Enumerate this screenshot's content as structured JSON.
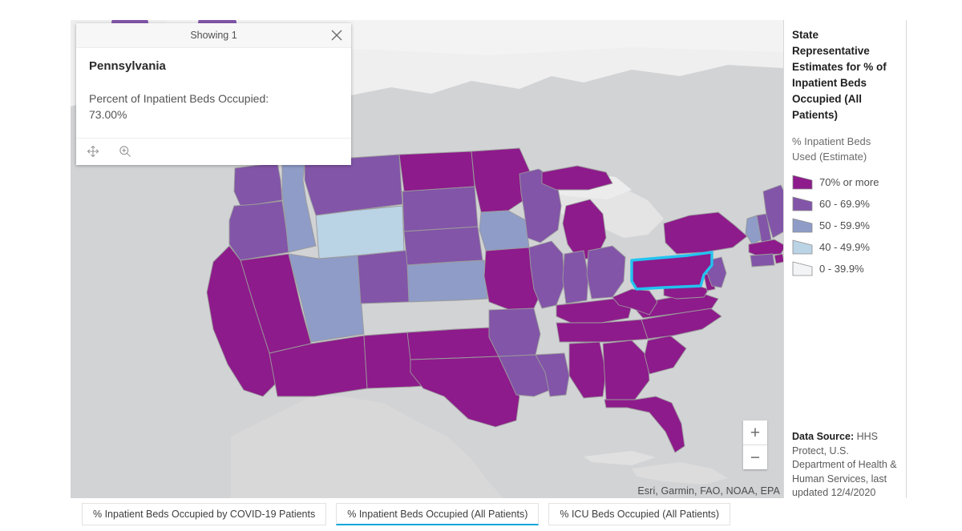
{
  "popup": {
    "header_title": "Showing 1",
    "close_icon": "close-icon",
    "feature_name": "Pennsylvania",
    "field_label": "Percent of Inpatient Beds Occupied:",
    "field_value": "73.00%",
    "actions": [
      {
        "icon": "pan-icon",
        "name": "pan-to-feature"
      },
      {
        "icon": "zoom-in-icon",
        "name": "zoom-to-feature"
      }
    ]
  },
  "legend": {
    "title": "State Representative Estimates for % of Inpatient Beds Occupied (All Patients)",
    "subtitle": "% Inpatient Beds Used (Estimate)",
    "items": [
      {
        "label": "70% or more",
        "color": "#8d1b8b"
      },
      {
        "label": "60 - 69.9%",
        "color": "#8255a8"
      },
      {
        "label": "50 - 59.9%",
        "color": "#8e9cc7"
      },
      {
        "label": "40 - 49.9%",
        "color": "#bad3e5"
      },
      {
        "label": "0 - 39.9%",
        "color": "#f2f4f6"
      }
    ],
    "source_label": "Data Source:",
    "source_text": " HHS Protect, U.S. Department of Health & Human Services, last updated 12/4/2020"
  },
  "map": {
    "attribution": "Esri, Garmin, FAO, NOAA, EPA",
    "zoom_in_label": "+",
    "zoom_out_label": "−",
    "selected_state": "Pennsylvania",
    "selection_outline_color": "#22c3f0",
    "background_color": "#d2d3d5",
    "land_color": "#e8e8e8",
    "water_color": "#f3f3f3",
    "state_values": [
      {
        "state": "WA",
        "bucket": "60 - 69.9%"
      },
      {
        "state": "OR",
        "bucket": "60 - 69.9%"
      },
      {
        "state": "CA",
        "bucket": "70% or more"
      },
      {
        "state": "NV",
        "bucket": "70% or more"
      },
      {
        "state": "ID",
        "bucket": "50 - 59.9%"
      },
      {
        "state": "MT",
        "bucket": "60 - 69.9%"
      },
      {
        "state": "WY",
        "bucket": "40 - 49.9%"
      },
      {
        "state": "UT",
        "bucket": "50 - 59.9%"
      },
      {
        "state": "AZ",
        "bucket": "70% or more"
      },
      {
        "state": "CO",
        "bucket": "60 - 69.9%"
      },
      {
        "state": "NM",
        "bucket": "70% or more"
      },
      {
        "state": "ND",
        "bucket": "70% or more"
      },
      {
        "state": "SD",
        "bucket": "60 - 69.9%"
      },
      {
        "state": "NE",
        "bucket": "60 - 69.9%"
      },
      {
        "state": "KS",
        "bucket": "50 - 59.9%"
      },
      {
        "state": "OK",
        "bucket": "70% or more"
      },
      {
        "state": "TX",
        "bucket": "70% or more"
      },
      {
        "state": "MN",
        "bucket": "70% or more"
      },
      {
        "state": "IA",
        "bucket": "50 - 59.9%"
      },
      {
        "state": "MO",
        "bucket": "70% or more"
      },
      {
        "state": "AR",
        "bucket": "60 - 69.9%"
      },
      {
        "state": "LA",
        "bucket": "60 - 69.9%"
      },
      {
        "state": "WI",
        "bucket": "60 - 69.9%"
      },
      {
        "state": "IL",
        "bucket": "60 - 69.9%"
      },
      {
        "state": "MS",
        "bucket": "60 - 69.9%"
      },
      {
        "state": "MI",
        "bucket": "70% or more"
      },
      {
        "state": "IN",
        "bucket": "60 - 69.9%"
      },
      {
        "state": "OH",
        "bucket": "60 - 69.9%"
      },
      {
        "state": "KY",
        "bucket": "70% or more"
      },
      {
        "state": "TN",
        "bucket": "70% or more"
      },
      {
        "state": "AL",
        "bucket": "70% or more"
      },
      {
        "state": "GA",
        "bucket": "70% or more"
      },
      {
        "state": "FL",
        "bucket": "70% or more"
      },
      {
        "state": "SC",
        "bucket": "70% or more"
      },
      {
        "state": "NC",
        "bucket": "70% or more"
      },
      {
        "state": "VA",
        "bucket": "70% or more"
      },
      {
        "state": "WV",
        "bucket": "70% or more"
      },
      {
        "state": "PA",
        "bucket": "70% or more"
      },
      {
        "state": "NY",
        "bucket": "70% or more"
      },
      {
        "state": "VT",
        "bucket": "50 - 59.9%"
      },
      {
        "state": "NH",
        "bucket": "60 - 69.9%"
      },
      {
        "state": "ME",
        "bucket": "60 - 69.9%"
      },
      {
        "state": "MA",
        "bucket": "70% or more"
      },
      {
        "state": "RI",
        "bucket": "70% or more"
      },
      {
        "state": "CT",
        "bucket": "60 - 69.9%"
      },
      {
        "state": "NJ",
        "bucket": "60 - 69.9%"
      },
      {
        "state": "DE",
        "bucket": "70% or more"
      },
      {
        "state": "MD",
        "bucket": "70% or more"
      }
    ]
  },
  "tabs": [
    {
      "label": "% Inpatient Beds Occupied by COVID-19 Patients",
      "active": false
    },
    {
      "label": "% Inpatient Beds Occupied (All Patients)",
      "active": true
    },
    {
      "label": "% ICU Beds Occupied (All Patients)",
      "active": false
    }
  ]
}
